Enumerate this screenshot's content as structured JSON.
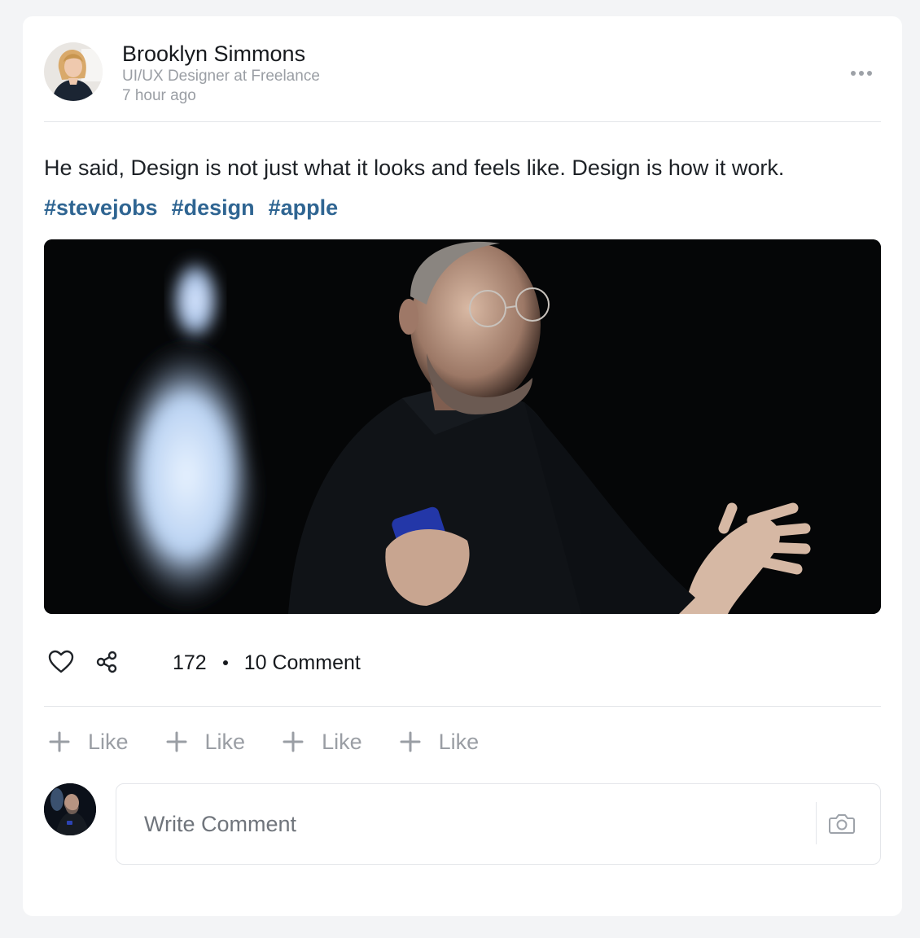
{
  "post": {
    "author": {
      "name": "Brooklyn Simmons",
      "role": "UI/UX Designer at Freelance",
      "time": "7 hour ago"
    },
    "text": "He said, Design is not just what it looks and feels like. Design is how it work.",
    "hashtags": [
      "#stevejobs",
      "#design",
      "#apple"
    ],
    "stats": {
      "likes": "172",
      "comments": "10 Comment"
    },
    "reactions": [
      {
        "label": "Like"
      },
      {
        "label": "Like"
      },
      {
        "label": "Like"
      },
      {
        "label": "Like"
      }
    ]
  },
  "composer": {
    "placeholder": "Write Comment"
  },
  "icons": {
    "more": "more-horizontal-icon",
    "like": "heart-icon",
    "share": "share-icon",
    "reaction": "plus-icon",
    "camera": "camera-icon"
  },
  "colors": {
    "hashtag": "#2f6592",
    "muted": "#9a9ea4",
    "card": "#ffffff",
    "background": "#f3f4f6"
  }
}
